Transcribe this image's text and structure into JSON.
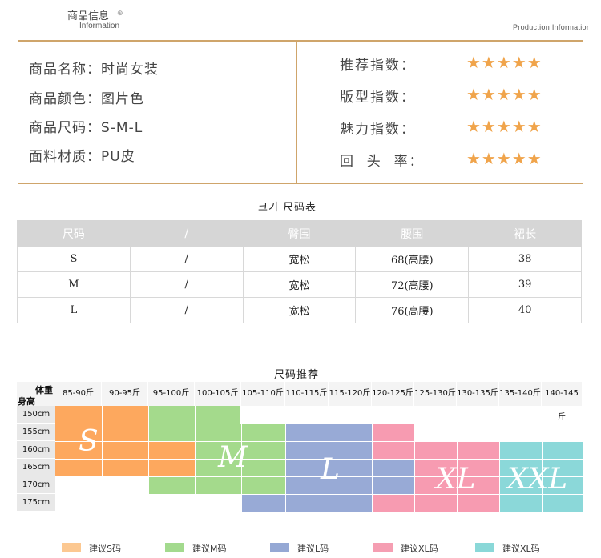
{
  "header": {
    "title": "商品信息",
    "plus": "⊕",
    "subtitle": "Information",
    "right_text": "Production Informatior"
  },
  "info": {
    "rows": [
      {
        "label": "商品名称：时尚女装"
      },
      {
        "label": "商品颜色：图片色"
      },
      {
        "label": "商品尺码：S-M-L"
      },
      {
        "label": "面料材质：PU皮"
      }
    ],
    "ratings": [
      {
        "label": "推荐指数：",
        "stars": "★★★★★"
      },
      {
        "label": "版型指数：",
        "stars": "★★★★★"
      },
      {
        "label": "魅力指数：",
        "stars": "★★★★★"
      },
      {
        "label": "回  头  率：",
        "stars": "★★★★★"
      }
    ]
  },
  "size_table": {
    "title": "크기 尺码表",
    "headers": [
      "尺码",
      "/",
      "臀围",
      "腰围",
      "裙长"
    ],
    "rows": [
      [
        "S",
        "/",
        "宽松",
        "68(高腰)",
        "38"
      ],
      [
        "M",
        "/",
        "宽松",
        "72(高腰)",
        "39"
      ],
      [
        "L",
        "/",
        "宽松",
        "76(高腰)",
        "40"
      ]
    ]
  },
  "recommend": {
    "title": "尺码推荐",
    "corner_weight": "体重",
    "corner_height": "身高",
    "weights": [
      "85-90斤",
      "90-95斤",
      "95-100斤",
      "100-105斤",
      "105-110斤",
      "110-115斤",
      "115-120斤",
      "120-125斤",
      "125-130斤",
      "130-135斤",
      "135-140斤",
      "140-145斤"
    ],
    "heights": [
      "150cm",
      "155cm",
      "160cm",
      "165cm",
      "170cm",
      "175cm"
    ],
    "sizes": {
      "s": "S",
      "m": "M",
      "l": "L",
      "xl": "XL",
      "xxl": "XXL"
    },
    "legend": [
      {
        "label": "建议S码",
        "color": "#fcc891"
      },
      {
        "label": "建议M码",
        "color": "#a3da8e"
      },
      {
        "label": "建议L码",
        "color": "#95a8d4"
      },
      {
        "label": "建议XL码",
        "color": "#f59eb2"
      },
      {
        "label": "建议XL码",
        "color": "#8ad8d8"
      }
    ],
    "colors": {
      "s": "#fda85e",
      "m": "#a4da8c",
      "l": "#98aad6",
      "xl": "#f79bb1",
      "xxl": "#8bd8d9"
    }
  }
}
